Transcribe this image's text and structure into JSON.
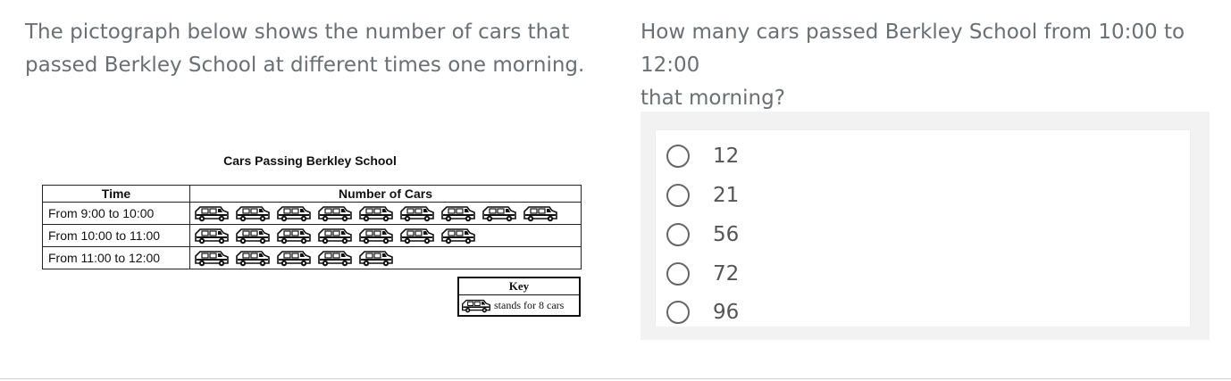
{
  "prompt": {
    "line1": "The pictograph below shows the number of cars that",
    "line2": "passed Berkley School at different times one morning."
  },
  "question": {
    "line1": "How many cars passed Berkley School from 10:00 to 12:00",
    "line2": "that morning?"
  },
  "pictograph": {
    "title": "Cars Passing Berkley School",
    "col_time": "Time",
    "col_cars": "Number of Cars",
    "rows": [
      {
        "time": "From 9:00 to 10:00",
        "icons": 9
      },
      {
        "time": "From 10:00 to 11:00",
        "icons": 7
      },
      {
        "time": "From 11:00 to 12:00",
        "icons": 5
      }
    ],
    "key_title": "Key",
    "key_text": "stands for 8 cars",
    "icon": "car-icon"
  },
  "options": [
    "12",
    "21",
    "56",
    "72",
    "96"
  ],
  "colors": {
    "text": "#6a6f73",
    "panel": "#f2f2f2",
    "radio_border": "#666666"
  }
}
